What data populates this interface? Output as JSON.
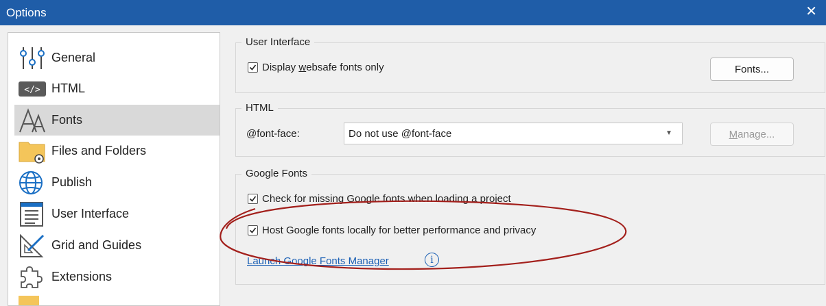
{
  "window": {
    "title": "Options",
    "close_glyph": "✕"
  },
  "sidebar": {
    "items": [
      {
        "label": "General",
        "icon": "sliders-icon"
      },
      {
        "label": "HTML",
        "icon": "code-icon"
      },
      {
        "label": "Fonts",
        "icon": "fonts-icon",
        "selected": true
      },
      {
        "label": "Files and Folders",
        "icon": "folder-gear-icon"
      },
      {
        "label": "Publish",
        "icon": "globe-icon"
      },
      {
        "label": "User Interface",
        "icon": "window-icon"
      },
      {
        "label": "Grid and Guides",
        "icon": "ruler-triangle-icon"
      },
      {
        "label": "Extensions",
        "icon": "puzzle-icon"
      }
    ]
  },
  "user_interface": {
    "legend": "User Interface",
    "websafe_prefix": "Display ",
    "websafe_accel": "w",
    "websafe_suffix": "ebsafe fonts only",
    "websafe_checked": true,
    "fonts_button": "Fonts..."
  },
  "html_group": {
    "legend": "HTML",
    "fontface_label": "@font-face:",
    "fontface_value": "Do not use @font-face",
    "manage_accel": "M",
    "manage_rest": "anage..."
  },
  "google_fonts": {
    "legend": "Google Fonts",
    "check_missing": "Check for missing Google fonts when loading a project",
    "check_missing_checked": true,
    "host_locally": "Host Google fonts locally for better performance and privacy",
    "host_locally_checked": true,
    "launch_link": "Launch Google Fonts Manager",
    "info_glyph": "i"
  },
  "colors": {
    "titlebar": "#1f5da8",
    "annotation": "#a3201c",
    "link": "#1a5fb4"
  }
}
